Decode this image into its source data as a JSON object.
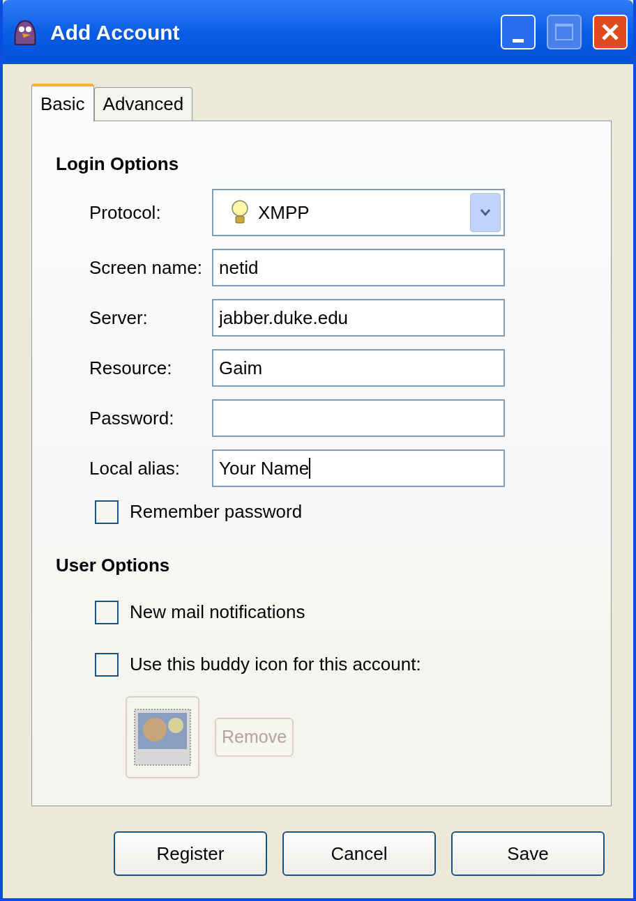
{
  "window": {
    "title": "Add Account"
  },
  "tabs": [
    {
      "label": "Basic",
      "selected": true
    },
    {
      "label": "Advanced",
      "selected": false
    }
  ],
  "login_options": {
    "heading": "Login Options",
    "fields": [
      {
        "kind": "dropdown",
        "label": "Protocol:",
        "value": "XMPP"
      },
      {
        "kind": "text",
        "label": "Screen name:",
        "value": "netid"
      },
      {
        "kind": "text",
        "label": "Server:",
        "value": "jabber.duke.edu"
      },
      {
        "kind": "text",
        "label": "Resource:",
        "value": "Gaim"
      },
      {
        "kind": "password",
        "label": "Password:"
      },
      {
        "kind": "text",
        "label": "Local alias:",
        "value": "Your Name",
        "focused": true
      }
    ],
    "remember_password": {
      "label": "Remember password",
      "checked": false
    }
  },
  "user_options": {
    "heading": "User Options",
    "checkboxes": [
      {
        "label": "New mail notifications",
        "checked": false
      },
      {
        "label": "Use this buddy icon for this account:",
        "checked": false
      }
    ],
    "remove_button": {
      "label": "Remove",
      "disabled": true
    }
  },
  "buttons": [
    {
      "label": "Register"
    },
    {
      "label": "Cancel"
    },
    {
      "label": "Save"
    }
  ]
}
